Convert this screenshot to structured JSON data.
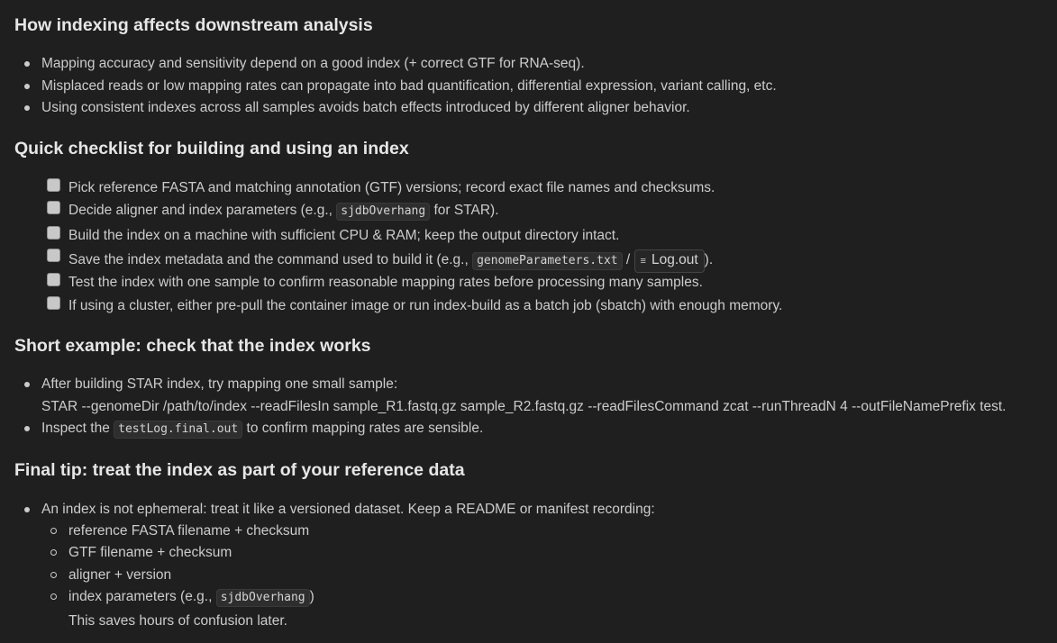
{
  "sections": {
    "downstream": {
      "heading": "How indexing affects downstream analysis",
      "items": [
        "Mapping accuracy and sensitivity depend on a good index (+ correct GTF for RNA-seq).",
        "Misplaced reads or low mapping rates can propagate into bad quantification, differential expression, variant calling, etc.",
        "Using consistent indexes across all samples avoids batch effects introduced by different aligner behavior."
      ]
    },
    "checklist": {
      "heading": "Quick checklist for building and using an index",
      "item1": "Pick reference FASTA and matching annotation (GTF) versions; record exact file names and checksums.",
      "item2_pre": "Decide aligner and index parameters (e.g., ",
      "item2_code": "sjdbOverhang",
      "item2_post": " for STAR).",
      "item3": "Build the index on a machine with sufficient CPU & RAM; keep the output directory intact.",
      "item4_pre": "Save the index metadata and the command used to build it (e.g., ",
      "item4_code": "genomeParameters.txt",
      "item4_sep": " / ",
      "item4_file": "Log.out",
      "item4_post": ").",
      "item5": "Test the index with one sample to confirm reasonable mapping rates before processing many samples.",
      "item6": "If using a cluster, either pre-pull the container image or run index-build as a batch job (sbatch) with enough memory."
    },
    "example": {
      "heading": "Short example: check that the index works",
      "item1_line1": "After building STAR index, try mapping one small sample:",
      "item1_line2": "STAR --genomeDir /path/to/index --readFilesIn sample_R1.fastq.gz sample_R2.fastq.gz --readFilesCommand zcat --runThreadN 4 --outFileNamePrefix test.",
      "item2_pre": "Inspect the ",
      "item2_code": "testLog.final.out",
      "item2_post": " to confirm mapping rates are sensible."
    },
    "final": {
      "heading": "Final tip: treat the index as part of your reference data",
      "item1": "An index is not ephemeral: treat it like a versioned dataset. Keep a README or manifest recording:",
      "sub1": "reference FASTA filename + checksum",
      "sub2": "GTF filename + checksum",
      "sub3": "aligner + version",
      "sub4_pre": "index parameters (e.g., ",
      "sub4_code": "sjdbOverhang",
      "sub4_post": ")",
      "note": "This saves hours of confusion later."
    }
  },
  "icons": {
    "file_icon": "file-lines-icon"
  }
}
